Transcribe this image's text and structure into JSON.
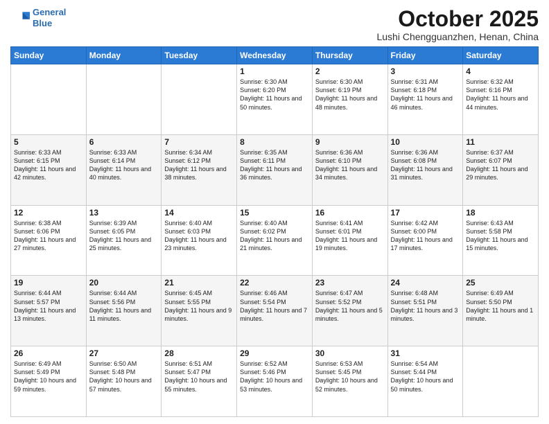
{
  "header": {
    "logo_line1": "General",
    "logo_line2": "Blue",
    "month_title": "October 2025",
    "location": "Lushi Chengguanzhen, Henan, China"
  },
  "weekdays": [
    "Sunday",
    "Monday",
    "Tuesday",
    "Wednesday",
    "Thursday",
    "Friday",
    "Saturday"
  ],
  "weeks": [
    [
      {
        "day": "",
        "info": ""
      },
      {
        "day": "",
        "info": ""
      },
      {
        "day": "",
        "info": ""
      },
      {
        "day": "1",
        "info": "Sunrise: 6:30 AM\nSunset: 6:20 PM\nDaylight: 11 hours\nand 50 minutes."
      },
      {
        "day": "2",
        "info": "Sunrise: 6:30 AM\nSunset: 6:19 PM\nDaylight: 11 hours\nand 48 minutes."
      },
      {
        "day": "3",
        "info": "Sunrise: 6:31 AM\nSunset: 6:18 PM\nDaylight: 11 hours\nand 46 minutes."
      },
      {
        "day": "4",
        "info": "Sunrise: 6:32 AM\nSunset: 6:16 PM\nDaylight: 11 hours\nand 44 minutes."
      }
    ],
    [
      {
        "day": "5",
        "info": "Sunrise: 6:33 AM\nSunset: 6:15 PM\nDaylight: 11 hours\nand 42 minutes."
      },
      {
        "day": "6",
        "info": "Sunrise: 6:33 AM\nSunset: 6:14 PM\nDaylight: 11 hours\nand 40 minutes."
      },
      {
        "day": "7",
        "info": "Sunrise: 6:34 AM\nSunset: 6:12 PM\nDaylight: 11 hours\nand 38 minutes."
      },
      {
        "day": "8",
        "info": "Sunrise: 6:35 AM\nSunset: 6:11 PM\nDaylight: 11 hours\nand 36 minutes."
      },
      {
        "day": "9",
        "info": "Sunrise: 6:36 AM\nSunset: 6:10 PM\nDaylight: 11 hours\nand 34 minutes."
      },
      {
        "day": "10",
        "info": "Sunrise: 6:36 AM\nSunset: 6:08 PM\nDaylight: 11 hours\nand 31 minutes."
      },
      {
        "day": "11",
        "info": "Sunrise: 6:37 AM\nSunset: 6:07 PM\nDaylight: 11 hours\nand 29 minutes."
      }
    ],
    [
      {
        "day": "12",
        "info": "Sunrise: 6:38 AM\nSunset: 6:06 PM\nDaylight: 11 hours\nand 27 minutes."
      },
      {
        "day": "13",
        "info": "Sunrise: 6:39 AM\nSunset: 6:05 PM\nDaylight: 11 hours\nand 25 minutes."
      },
      {
        "day": "14",
        "info": "Sunrise: 6:40 AM\nSunset: 6:03 PM\nDaylight: 11 hours\nand 23 minutes."
      },
      {
        "day": "15",
        "info": "Sunrise: 6:40 AM\nSunset: 6:02 PM\nDaylight: 11 hours\nand 21 minutes."
      },
      {
        "day": "16",
        "info": "Sunrise: 6:41 AM\nSunset: 6:01 PM\nDaylight: 11 hours\nand 19 minutes."
      },
      {
        "day": "17",
        "info": "Sunrise: 6:42 AM\nSunset: 6:00 PM\nDaylight: 11 hours\nand 17 minutes."
      },
      {
        "day": "18",
        "info": "Sunrise: 6:43 AM\nSunset: 5:58 PM\nDaylight: 11 hours\nand 15 minutes."
      }
    ],
    [
      {
        "day": "19",
        "info": "Sunrise: 6:44 AM\nSunset: 5:57 PM\nDaylight: 11 hours\nand 13 minutes."
      },
      {
        "day": "20",
        "info": "Sunrise: 6:44 AM\nSunset: 5:56 PM\nDaylight: 11 hours\nand 11 minutes."
      },
      {
        "day": "21",
        "info": "Sunrise: 6:45 AM\nSunset: 5:55 PM\nDaylight: 11 hours\nand 9 minutes."
      },
      {
        "day": "22",
        "info": "Sunrise: 6:46 AM\nSunset: 5:54 PM\nDaylight: 11 hours\nand 7 minutes."
      },
      {
        "day": "23",
        "info": "Sunrise: 6:47 AM\nSunset: 5:52 PM\nDaylight: 11 hours\nand 5 minutes."
      },
      {
        "day": "24",
        "info": "Sunrise: 6:48 AM\nSunset: 5:51 PM\nDaylight: 11 hours\nand 3 minutes."
      },
      {
        "day": "25",
        "info": "Sunrise: 6:49 AM\nSunset: 5:50 PM\nDaylight: 11 hours\nand 1 minute."
      }
    ],
    [
      {
        "day": "26",
        "info": "Sunrise: 6:49 AM\nSunset: 5:49 PM\nDaylight: 10 hours\nand 59 minutes."
      },
      {
        "day": "27",
        "info": "Sunrise: 6:50 AM\nSunset: 5:48 PM\nDaylight: 10 hours\nand 57 minutes."
      },
      {
        "day": "28",
        "info": "Sunrise: 6:51 AM\nSunset: 5:47 PM\nDaylight: 10 hours\nand 55 minutes."
      },
      {
        "day": "29",
        "info": "Sunrise: 6:52 AM\nSunset: 5:46 PM\nDaylight: 10 hours\nand 53 minutes."
      },
      {
        "day": "30",
        "info": "Sunrise: 6:53 AM\nSunset: 5:45 PM\nDaylight: 10 hours\nand 52 minutes."
      },
      {
        "day": "31",
        "info": "Sunrise: 6:54 AM\nSunset: 5:44 PM\nDaylight: 10 hours\nand 50 minutes."
      },
      {
        "day": "",
        "info": ""
      }
    ]
  ]
}
